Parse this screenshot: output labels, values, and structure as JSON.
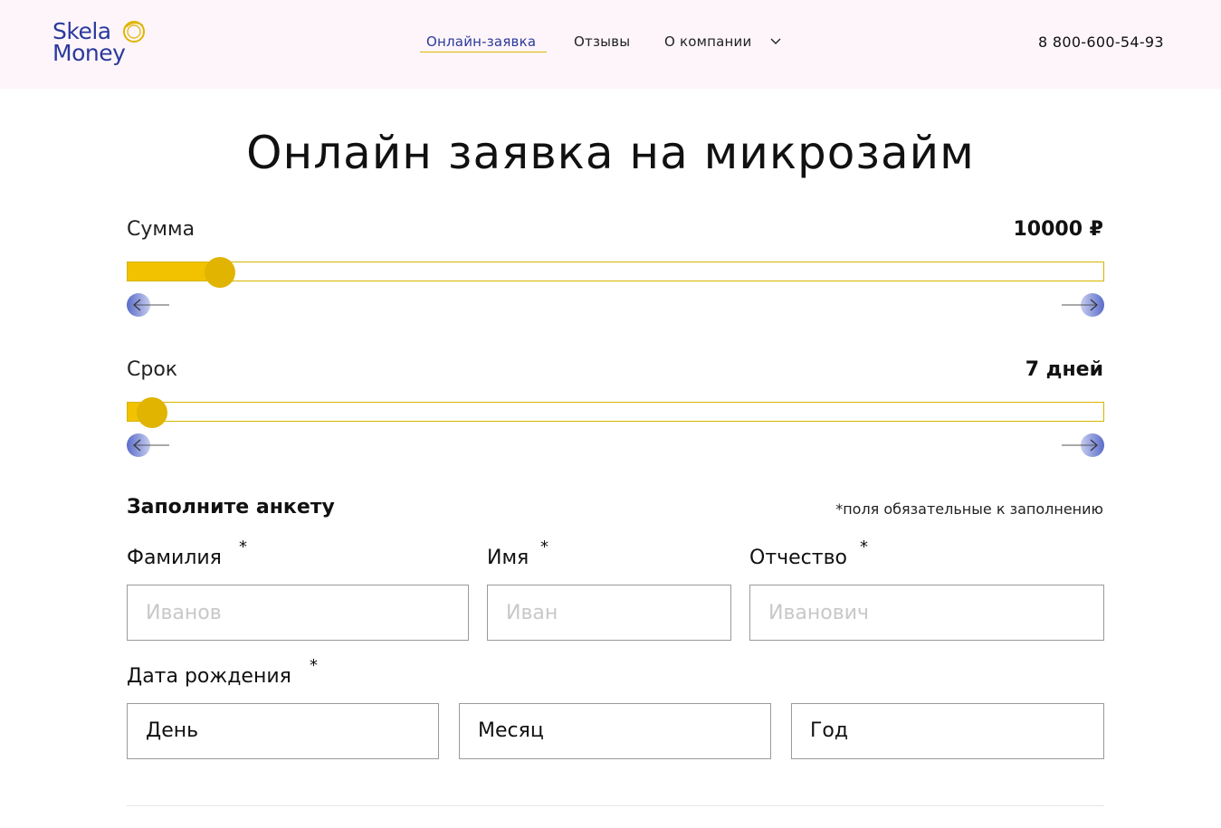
{
  "header": {
    "logo_line1": "Skela",
    "logo_line2": "Money",
    "nav": {
      "online_application": "Онлайн-заявка",
      "reviews": "Отзывы",
      "about": "О компании"
    },
    "phone": "8 800-600-54-93"
  },
  "page_title": "Онлайн заявка на микрозайм",
  "amount_slider": {
    "label": "Сумма",
    "value_text": "10000 ₽",
    "fill_fraction": 0.093
  },
  "term_slider": {
    "label": "Срок",
    "value_text": "7 дней",
    "fill_fraction": 0.023
  },
  "form": {
    "title": "Заполните анкету",
    "required_note": "*поля обязательные к заполнению",
    "asterisk": "*",
    "last_name": {
      "label": "Фамилия",
      "placeholder": "Иванов"
    },
    "first_name": {
      "label": "Имя",
      "placeholder": "Иван"
    },
    "patronymic": {
      "label": "Отчество",
      "placeholder": "Иванович"
    },
    "birth_date": {
      "label": "Дата рождения",
      "day": "День",
      "month": "Месяц",
      "year": "Год"
    }
  },
  "colors": {
    "brand_blue": "#2b3a9c",
    "accent_yellow": "#f2c200",
    "header_bg": "#fdf5fa"
  }
}
